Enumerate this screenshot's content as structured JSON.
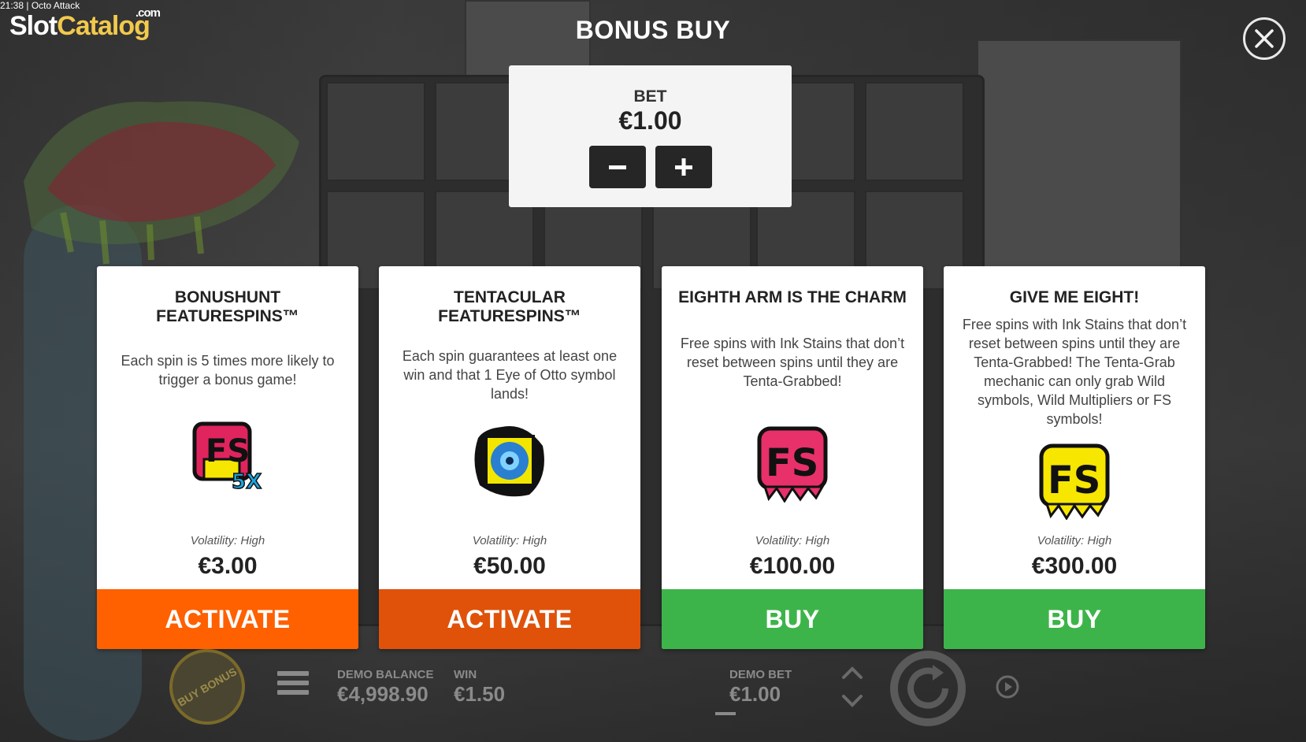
{
  "clock": "21:38",
  "window_title": "Octo Attack",
  "watermark": {
    "part1": "Slot",
    "part2": "Catalog",
    "suffix": ".com"
  },
  "dialog_title": "BONUS BUY",
  "bet": {
    "label": "BET",
    "value": "€1.00",
    "decrease_icon": "minus-icon",
    "increase_icon": "plus-icon"
  },
  "cards": [
    {
      "title": "BONUSHUNT FEATURESPINS™",
      "description": "Each spin is 5 times more likely to trigger a bonus game!",
      "icon": "fs-5x-icon",
      "volatility": "Volatility: High",
      "price": "€3.00",
      "cta": "ACTIVATE",
      "cta_color": "#ff6000"
    },
    {
      "title": "TENTACULAR FEATURESPINS™",
      "description": "Each spin guarantees at least one win and that 1 Eye of Otto symbol lands!",
      "icon": "eye-of-otto-icon",
      "volatility": "Volatility: High",
      "price": "€50.00",
      "cta": "ACTIVATE",
      "cta_color": "#e0520a"
    },
    {
      "title": "EIGHTH ARM IS THE CHARM",
      "description": "Free spins with Ink Stains that don’t reset between spins until they are Tenta-Grabbed!",
      "icon": "fs-pink-icon",
      "volatility": "Volatility: High",
      "price": "€100.00",
      "cta": "BUY",
      "cta_color": "#3db44a"
    },
    {
      "title": "GIVE ME EIGHT!",
      "description": "Free spins with Ink Stains that don’t reset between spins until they are Tenta-Grabbed! The Tenta-Grab mechanic can only grab Wild symbols, Wild Multipliers or FS symbols!",
      "icon": "fs-yellow-icon",
      "volatility": "Volatility: High",
      "price": "€300.00",
      "cta": "BUY",
      "cta_color": "#3db44a"
    }
  ],
  "bottom_bar": {
    "buy_bonus_label": "BUY BONUS",
    "demo_balance_label": "DEMO BALANCE",
    "demo_balance_value": "€4,998.90",
    "win_label": "WIN",
    "win_value": "€1.50",
    "demo_bet_label": "DEMO BET",
    "demo_bet_value": "€1.00"
  }
}
